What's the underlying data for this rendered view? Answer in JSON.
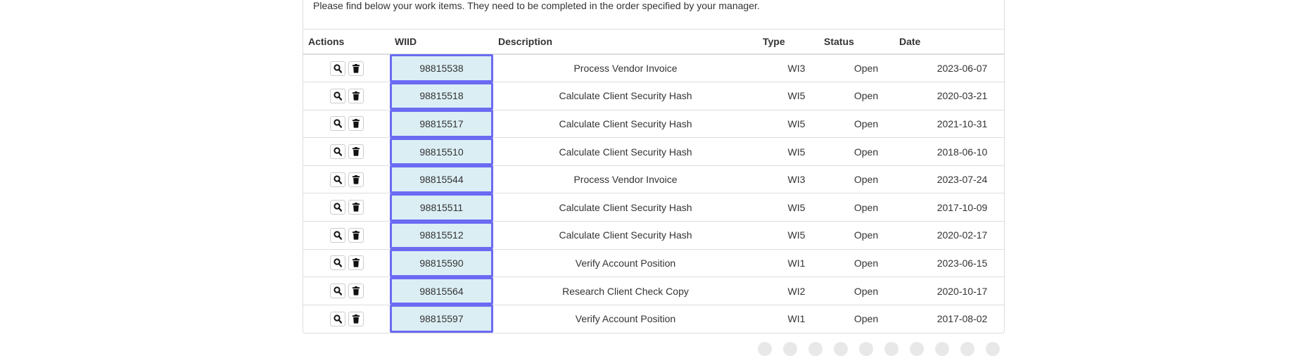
{
  "intro": "Please find below your work items. They need to be completed in the order specified by your manager.",
  "headers": {
    "actions": "Actions",
    "wiid": "WIID",
    "description": "Description",
    "type": "Type",
    "status": "Status",
    "date": "Date"
  },
  "icons": {
    "view": "search-icon",
    "delete": "trash-icon"
  },
  "colors": {
    "wiid_background": "#dbeef4",
    "wiid_border": "#6b6bf2"
  },
  "rows": [
    {
      "wiid": "98815538",
      "description": "Process Vendor Invoice",
      "type": "WI3",
      "status": "Open",
      "date": "2023-06-07"
    },
    {
      "wiid": "98815518",
      "description": "Calculate Client Security Hash",
      "type": "WI5",
      "status": "Open",
      "date": "2020-03-21"
    },
    {
      "wiid": "98815517",
      "description": "Calculate Client Security Hash",
      "type": "WI5",
      "status": "Open",
      "date": "2021-10-31"
    },
    {
      "wiid": "98815510",
      "description": "Calculate Client Security Hash",
      "type": "WI5",
      "status": "Open",
      "date": "2018-06-10"
    },
    {
      "wiid": "98815544",
      "description": "Process Vendor Invoice",
      "type": "WI3",
      "status": "Open",
      "date": "2023-07-24"
    },
    {
      "wiid": "98815511",
      "description": "Calculate Client Security Hash",
      "type": "WI5",
      "status": "Open",
      "date": "2017-10-09"
    },
    {
      "wiid": "98815512",
      "description": "Calculate Client Security Hash",
      "type": "WI5",
      "status": "Open",
      "date": "2020-02-17"
    },
    {
      "wiid": "98815590",
      "description": "Verify Account Position",
      "type": "WI1",
      "status": "Open",
      "date": "2023-06-15"
    },
    {
      "wiid": "98815564",
      "description": "Research Client Check Copy",
      "type": "WI2",
      "status": "Open",
      "date": "2020-10-17"
    },
    {
      "wiid": "98815597",
      "description": "Verify Account Position",
      "type": "WI1",
      "status": "Open",
      "date": "2017-08-02"
    }
  ]
}
